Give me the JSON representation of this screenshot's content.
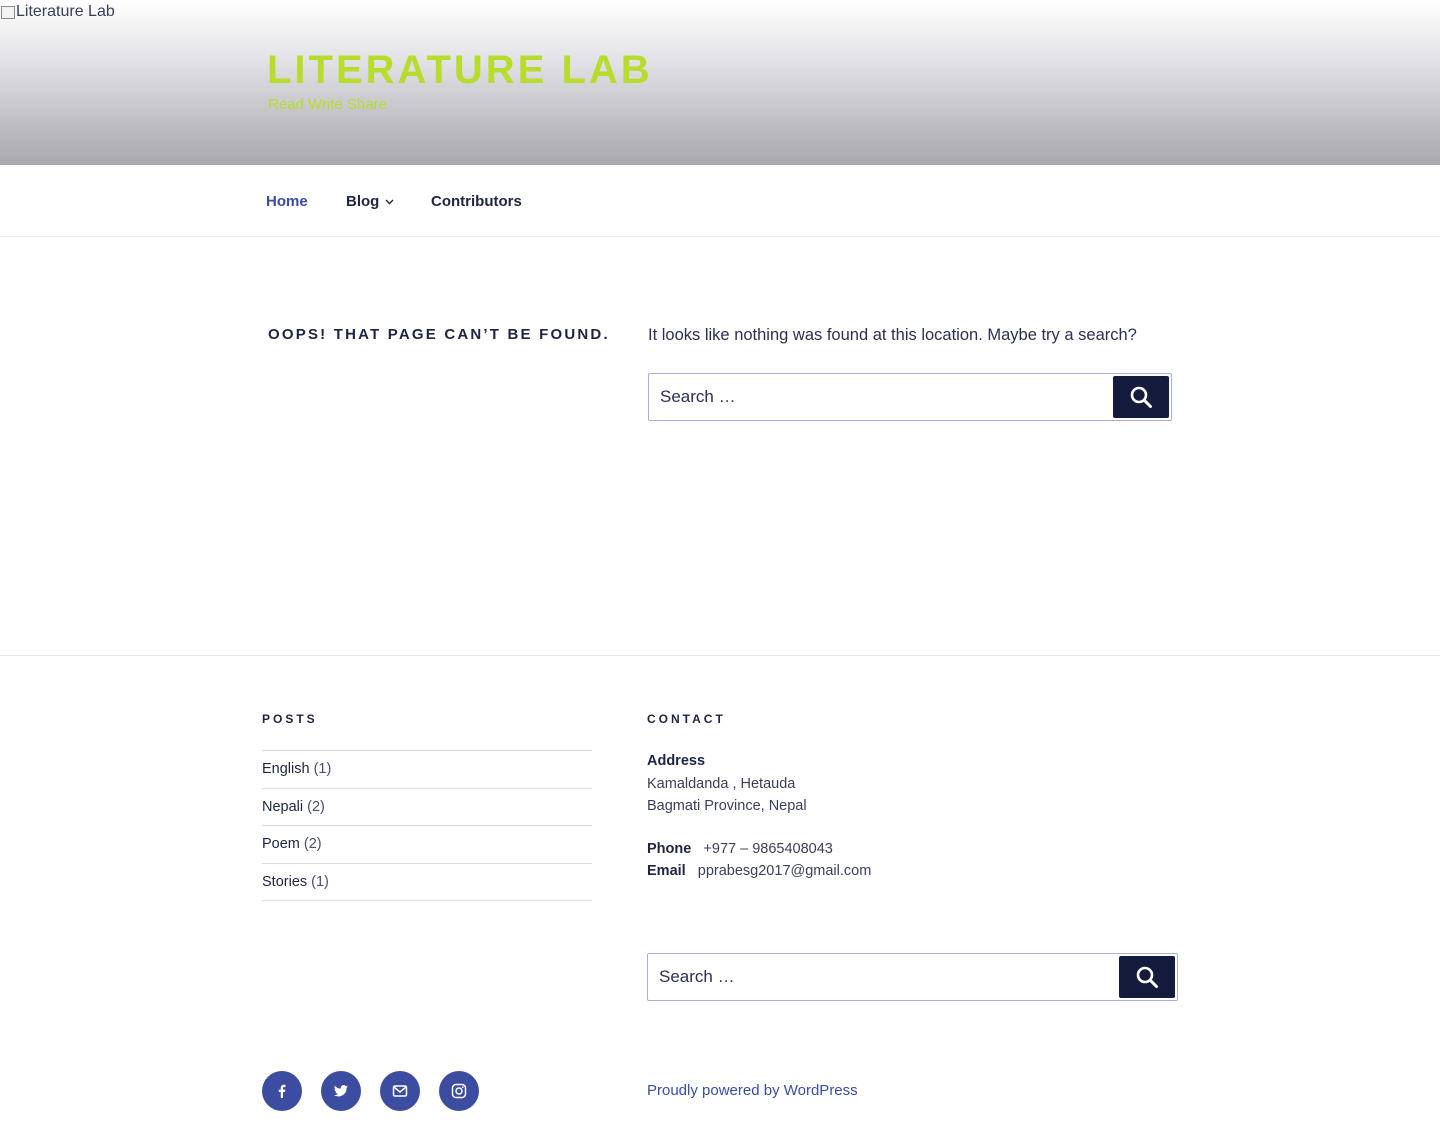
{
  "header": {
    "image_alt": "Literature Lab",
    "site_title": "Literature Lab",
    "site_description": "Read Write Share",
    "title_color": "#b8dc2c"
  },
  "nav": {
    "items": [
      {
        "label": "Home",
        "active": true
      },
      {
        "label": "Blog",
        "has_submenu": true
      },
      {
        "label": "Contributors"
      }
    ],
    "active_color": "#3b4ca1"
  },
  "content": {
    "error_title": "Oops! That page can’t be found.",
    "error_message": "It looks like nothing was found at this location. Maybe try a search?",
    "search_placeholder": "Search …",
    "search_icon": "search-icon"
  },
  "footer": {
    "posts_title": "Posts",
    "categories": [
      {
        "name": "English",
        "count": "(1)"
      },
      {
        "name": "Nepali",
        "count": "(2)"
      },
      {
        "name": "Poem",
        "count": "(2)"
      },
      {
        "name": "Stories",
        "count": "(1)"
      }
    ],
    "contact_title": "Contact",
    "address_label": "Address",
    "address_line1": "Kamaldanda , Hetauda",
    "address_line2": "Bagmati Province, Nepal",
    "phone_label": "Phone",
    "phone_value": "+977 – 9865408043",
    "email_label": "Email",
    "email_value": "pprabesg2017@gmail.com",
    "search_placeholder": "Search …",
    "social": [
      {
        "icon": "facebook-icon"
      },
      {
        "icon": "twitter-icon"
      },
      {
        "icon": "email-icon"
      },
      {
        "icon": "instagram-icon"
      }
    ],
    "powered_by": "Proudly powered by WordPress"
  }
}
